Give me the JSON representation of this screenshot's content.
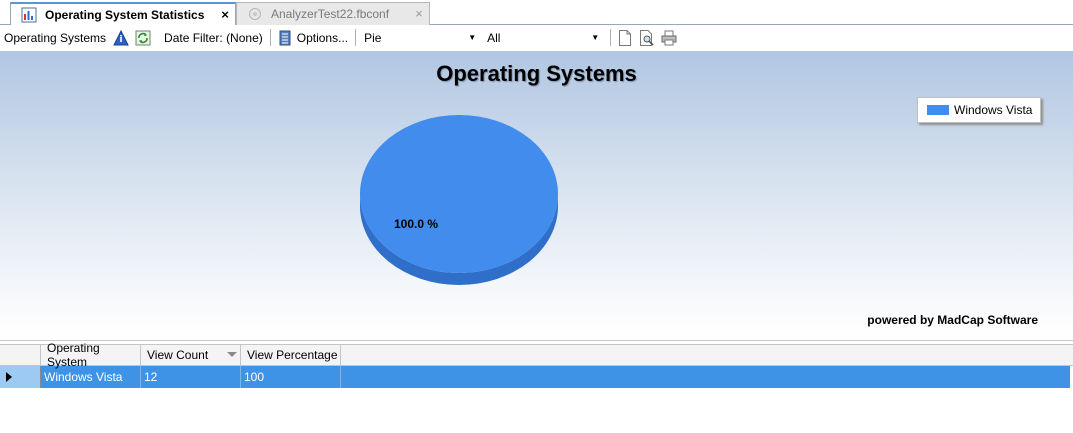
{
  "tabs": [
    {
      "title": "Operating System Statistics",
      "active": true,
      "close": "×"
    },
    {
      "title": "AnalyzerTest22.fbconf",
      "active": false,
      "close": "×"
    }
  ],
  "toolbar": {
    "report_name": "Operating Systems",
    "info_icon": "info-icon",
    "refresh_icon": "refresh-icon",
    "date_filter": "Date Filter: (None)",
    "options": "Options...",
    "chart_type": "Pie",
    "filter_value": "All",
    "export_icons": [
      "new-document-icon",
      "print-preview-icon",
      "print-icon"
    ]
  },
  "chart": {
    "title": "Operating Systems",
    "powered_by": "powered by MadCap Software",
    "colors": {
      "slice": "#418ced",
      "slice_side": "#2f6fca"
    }
  },
  "chart_data": {
    "type": "pie",
    "title": "Operating Systems",
    "categories": [
      "Windows Vista"
    ],
    "values": [
      100.0
    ],
    "labels": [
      "100.0 %"
    ],
    "legend": [
      "Windows Vista"
    ],
    "legend_position": "top-right"
  },
  "grid": {
    "columns": [
      "Operating System",
      "View Count",
      "View Percentage"
    ],
    "rows": [
      {
        "os": "Windows Vista",
        "count": "12",
        "percent": "100"
      }
    ]
  }
}
